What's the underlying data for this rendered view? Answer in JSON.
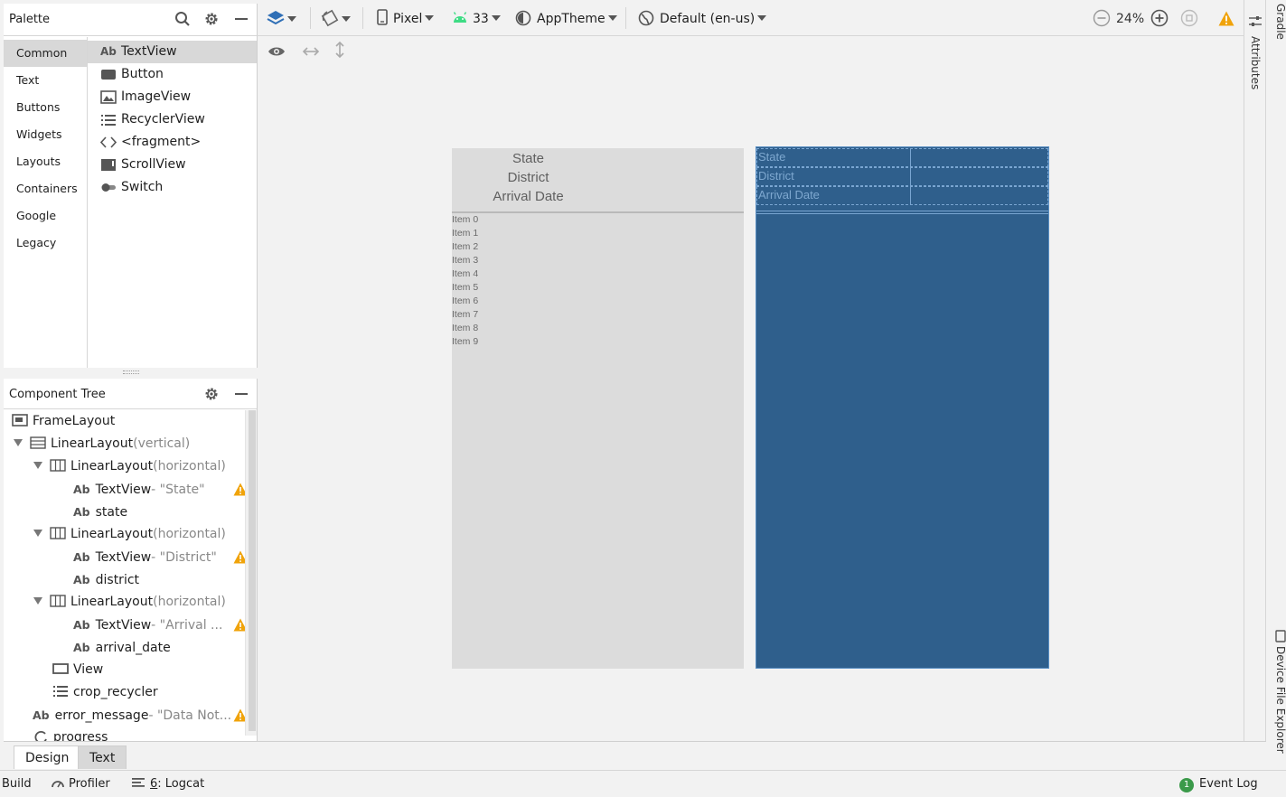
{
  "palette": {
    "title": "Palette",
    "categories": [
      "Common",
      "Text",
      "Buttons",
      "Widgets",
      "Layouts",
      "Containers",
      "Google",
      "Legacy"
    ],
    "selected_category": "Common",
    "widgets": [
      {
        "label": "TextView",
        "icon": "text-icon"
      },
      {
        "label": "Button",
        "icon": "button-icon"
      },
      {
        "label": "ImageView",
        "icon": "image-icon"
      },
      {
        "label": "RecyclerView",
        "icon": "list-icon"
      },
      {
        "label": "<fragment>",
        "icon": "code-icon"
      },
      {
        "label": "ScrollView",
        "icon": "scroll-icon"
      },
      {
        "label": "Switch",
        "icon": "switch-icon"
      }
    ]
  },
  "tree": {
    "title": "Component Tree",
    "rows": [
      {
        "name": "FrameLayout",
        "meta": ""
      },
      {
        "name": "LinearLayout",
        "meta": "(vertical)"
      },
      {
        "name": "LinearLayout",
        "meta": "(horizontal)"
      },
      {
        "name": "TextView",
        "meta": "- \"State\""
      },
      {
        "name": "state",
        "meta": ""
      },
      {
        "name": "LinearLayout",
        "meta": "(horizontal)"
      },
      {
        "name": "TextView",
        "meta": "- \"District\""
      },
      {
        "name": "district",
        "meta": ""
      },
      {
        "name": "LinearLayout",
        "meta": "(horizontal)"
      },
      {
        "name": "TextView",
        "meta": "- \"Arrival ..."
      },
      {
        "name": "arrival_date",
        "meta": ""
      },
      {
        "name": "View",
        "meta": ""
      },
      {
        "name": "crop_recycler",
        "meta": ""
      },
      {
        "name": "error_message",
        "meta": "- \"Data Not..."
      },
      {
        "name": "progress",
        "meta": ""
      }
    ]
  },
  "toolbar": {
    "device": "Pixel",
    "api": "33",
    "theme": "AppTheme",
    "locale": "Default (en-us)",
    "zoom": "24%"
  },
  "design": {
    "labels": [
      "State",
      "District",
      "Arrival Date"
    ],
    "items": [
      "Item 0",
      "Item 1",
      "Item 2",
      "Item 3",
      "Item 4",
      "Item 5",
      "Item 6",
      "Item 7",
      "Item 8",
      "Item 9"
    ]
  },
  "blueprint": {
    "labels": [
      "State",
      "District",
      "Arrival Date"
    ]
  },
  "side_tabs": {
    "gradle": "Gradle",
    "attributes": "Attributes",
    "device_explorer": "Device File Explorer"
  },
  "editor_tabs": {
    "design": "Design",
    "text": "Text"
  },
  "statusbar": {
    "build": "Build",
    "profiler": "Profiler",
    "logcat_num": "6",
    "logcat": ": Logcat",
    "event_badge": "1",
    "event_log": "Event Log"
  },
  "colors": {
    "blueprint_bg": "#2f5f8c",
    "design_bg": "#dcdcdc",
    "warning": "#f0a30a",
    "android_green": "#3ddc84"
  }
}
